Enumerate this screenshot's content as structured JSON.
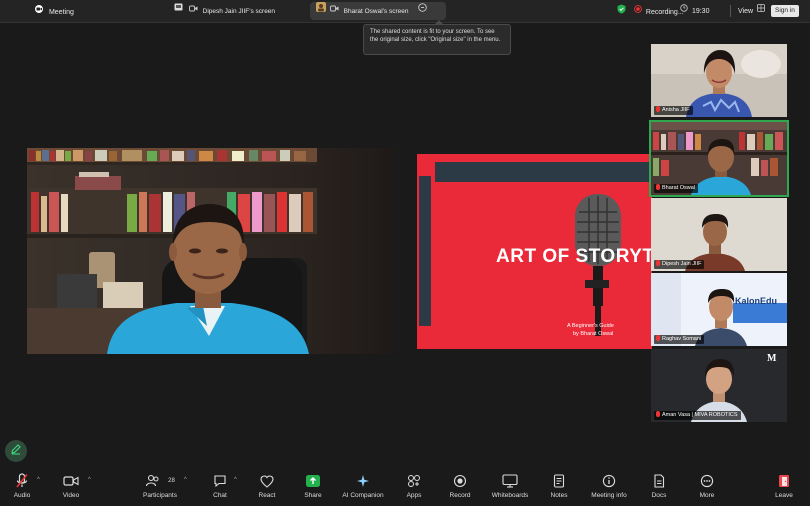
{
  "topbar": {
    "meeting_label": "Meeting",
    "tabs": [
      {
        "label": "Dipesh Jain JIIF's screen"
      },
      {
        "label": "Bharat Oswal's screen"
      }
    ],
    "recording_label": "Recording...",
    "timer": "19:30",
    "view_label": "View",
    "signin_label": "Sign in"
  },
  "tooltip": {
    "text": "The shared content is fit to your screen. To see the original size, click \"Original size\" in the menu."
  },
  "slide": {
    "title": "ART OF STORYTE",
    "subtitle_line1": "A Beginner's Guide",
    "subtitle_line2": "by Bharat Oswal"
  },
  "participants": [
    {
      "name": "Anisha JIIF"
    },
    {
      "name": "Bharat Oswal"
    },
    {
      "name": "Dipesh Jain JIIF"
    },
    {
      "name": "Raghav Somani"
    },
    {
      "name": "Aman Vasa | MIVA ROBOTICS"
    }
  ],
  "tile_extras": {
    "raghav_logo": "KalonEdu",
    "aman_logo": "M"
  },
  "toolbar": {
    "items": [
      {
        "label": "Audio"
      },
      {
        "label": "Video"
      },
      {
        "label": "Participants",
        "badge": "28"
      },
      {
        "label": "Chat"
      },
      {
        "label": "React"
      },
      {
        "label": "Share"
      },
      {
        "label": "AI Companion"
      },
      {
        "label": "Apps"
      },
      {
        "label": "Record"
      },
      {
        "label": "Whiteboards"
      },
      {
        "label": "Notes"
      },
      {
        "label": "Meeting info"
      },
      {
        "label": "Docs"
      },
      {
        "label": "More"
      },
      {
        "label": "Leave"
      }
    ]
  },
  "colors": {
    "slide_red": "#ea2a38",
    "active_green": "#2fa84f",
    "share_green": "#23b14d",
    "leave_red": "#e5484d",
    "mic_muted_red": "#e33333"
  }
}
